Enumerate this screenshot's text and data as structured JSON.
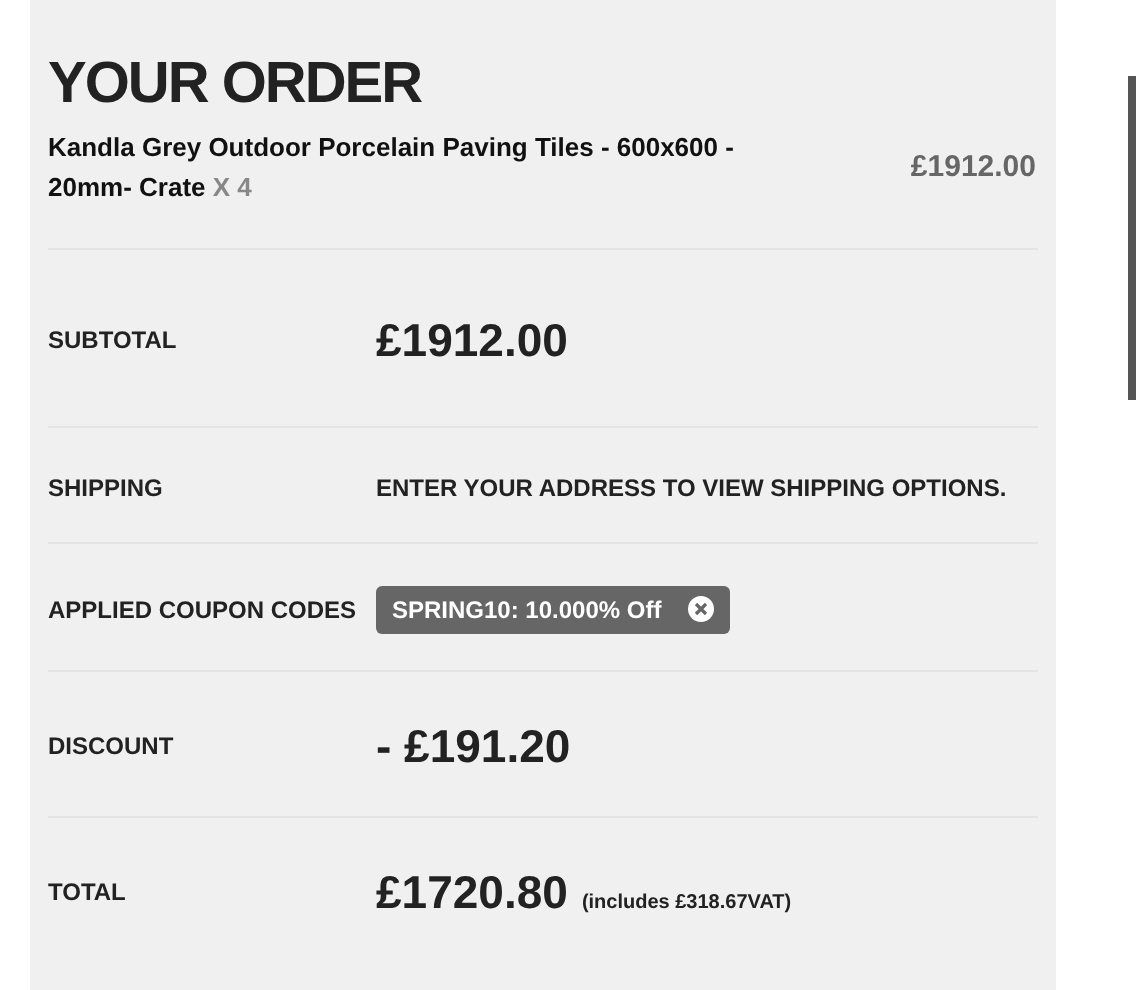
{
  "title": "YOUR ORDER",
  "item": {
    "name": "Kandla Grey Outdoor Porcelain Paving Tiles - 600x600 - 20mm- Crate",
    "quantity": "X 4",
    "price": "£1912.00"
  },
  "rows": [
    {
      "kind": "amount",
      "label": "SUBTOTAL",
      "value": "£1912.00"
    },
    {
      "kind": "text",
      "label": "SHIPPING",
      "value": "ENTER YOUR ADDRESS TO VIEW SHIPPING OPTIONS."
    },
    {
      "kind": "coupon",
      "label": "APPLIED COUPON CODES",
      "value": "SPRING10: 10.000% Off"
    },
    {
      "kind": "amount",
      "label": "DISCOUNT",
      "value": "- £191.20"
    },
    {
      "kind": "amount",
      "label": "TOTAL",
      "value": "£1720.80",
      "note": "(includes £318.67VAT)"
    }
  ]
}
